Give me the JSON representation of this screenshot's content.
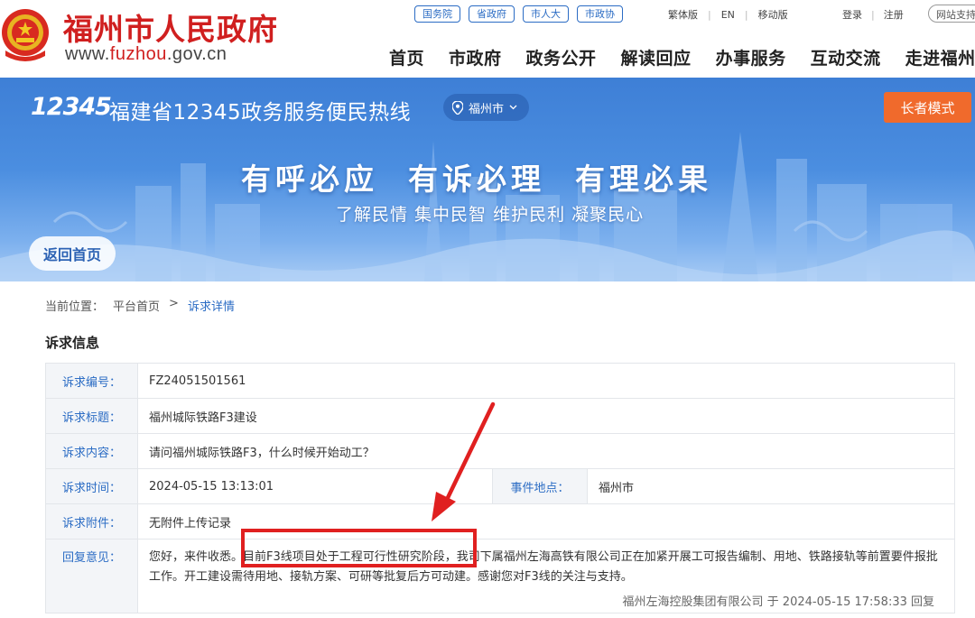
{
  "header": {
    "site_title": "福州市人民政府",
    "site_url_prefix": "www.",
    "site_url_domain": "fuzhou",
    "site_url_suffix": ".gov.cn",
    "gov_links": [
      "国务院",
      "省政府",
      "市人大",
      "市政协"
    ],
    "util_links": [
      "繁体版",
      "EN",
      "移动版"
    ],
    "login": "登录",
    "register": "注册",
    "search_hint": "网站支持",
    "nav": [
      "首页",
      "市政府",
      "政务公开",
      "解读回应",
      "办事服务",
      "互动交流",
      "走进福州"
    ],
    "brand_color": "#d01f1f"
  },
  "banner": {
    "logo": "12345",
    "title": "福建省12345政务服务便民热线",
    "city": "福州市",
    "elder_mode": "长者模式",
    "slogan_main": "有呼必应  有诉必理  有理必果",
    "slogan_sub": "了解民情 集中民智 维护民利 凝聚民心",
    "back_home": "返回首页"
  },
  "breadcrumb": {
    "prefix": "当前位置：",
    "home": "平台首页",
    "separator": ">",
    "current": "诉求详情"
  },
  "section_title": "诉求信息",
  "detail": {
    "id_label": "诉求编号：",
    "id_value": "FZ24051501561",
    "title_label": "诉求标题：",
    "title_value": "福州城际铁路F3建设",
    "content_label": "诉求内容：",
    "content_value": "请问福州城际铁路F3，什么时候开始动工？",
    "time_label": "诉求时间：",
    "time_value": "2024-05-15 13:13:01",
    "location_label": "事件地点：",
    "location_value": "福州市",
    "attach_label": "诉求附件：",
    "attach_value": "无附件上传记录",
    "reply_label": "回复意见：",
    "reply_value": "您好，来件收悉。目前F3线项目处于工程可行性研究阶段，我司下属福州左海高铁有限公司正在加紧开展工可报告编制、用地、铁路接轨等前置要件报批工作。开工建设需待用地、接轨方案、可研等批复后方可动建。感谢您对F3线的关注与支持。",
    "reply_sign": "福州左海控股集团有限公司 于 2024-05-15 17:58:33 回复"
  },
  "annotation_color": "#e02020"
}
